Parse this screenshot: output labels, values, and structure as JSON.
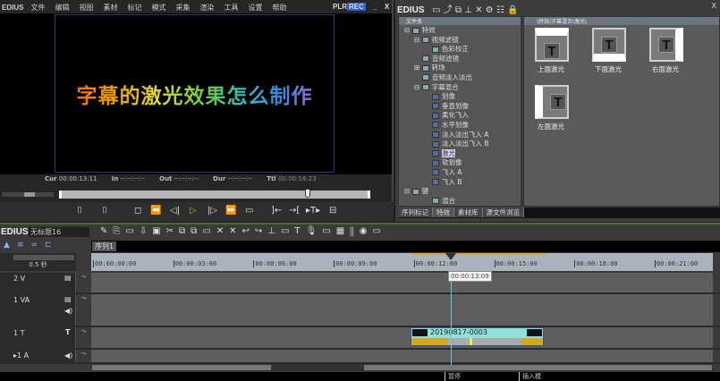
{
  "app": {
    "name": "EDIUS",
    "menu": [
      "文件",
      "编辑",
      "视图",
      "素材",
      "标记",
      "模式",
      "采集",
      "渲染",
      "工具",
      "设置",
      "帮助"
    ],
    "plr": "PLR",
    "rec": "REC",
    "minimize": "_",
    "close": "X"
  },
  "preview": {
    "title_text": "字幕的激光效果怎么制作",
    "cur_label": "Cur",
    "cur": "00:00:13:11",
    "in_label": "In",
    "in": "--:--:--:--",
    "out_label": "Out",
    "out": "--:--:--:--",
    "dur_label": "Dur",
    "dur": "--:--:--:--",
    "ttl_label": "Ttl",
    "ttl": "00:00:16:23",
    "playhead_fraction": 0.82
  },
  "transport": {
    "buttons": [
      "⌷",
      "⌷",
      "◻",
      "⏪",
      "◁|",
      "▷",
      "|▷",
      "⏩",
      "▭",
      "]←",
      "→[",
      "▸T▸",
      "⊟"
    ]
  },
  "effects": {
    "app": "EDIUS",
    "close": "X",
    "folder_header": "文件夹",
    "path": "\\特效\\字幕混合\\激光\\",
    "tree": [
      {
        "label": "特效",
        "level": 0,
        "exp": "⊟"
      },
      {
        "label": "视频滤镜",
        "level": 1,
        "exp": "⊟"
      },
      {
        "label": "色彩校正",
        "level": 2
      },
      {
        "label": "音频滤镜",
        "level": 1
      },
      {
        "label": "转场",
        "level": 1,
        "exp": "⊞"
      },
      {
        "label": "音频淡入淡出",
        "level": 1
      },
      {
        "label": "字幕混合",
        "level": 1,
        "exp": "⊟"
      },
      {
        "label": "划像",
        "level": 2,
        "t": true
      },
      {
        "label": "垂直划像",
        "level": 2,
        "t": true
      },
      {
        "label": "柔化飞入",
        "level": 2,
        "t": true
      },
      {
        "label": "水平划像",
        "level": 2,
        "t": true
      },
      {
        "label": "淡入淡出飞入 A",
        "level": 2,
        "t": true
      },
      {
        "label": "淡入淡出飞入 B",
        "level": 2,
        "t": true
      },
      {
        "label": "激光",
        "level": 2,
        "t": true,
        "selected": true
      },
      {
        "label": "软划像",
        "level": 2,
        "t": true
      },
      {
        "label": "飞入 A",
        "level": 2,
        "t": true
      },
      {
        "label": "飞入 B",
        "level": 2,
        "t": true
      },
      {
        "label": "键",
        "level": 0,
        "exp": "⊟"
      },
      {
        "label": "混合",
        "level": 2
      }
    ],
    "tiles": [
      "上面激光",
      "下面激光",
      "右面激光",
      "左面激光"
    ],
    "tabs": [
      "序列标记",
      "特效",
      "素材库",
      "源文件浏览"
    ]
  },
  "timeline": {
    "app": "EDIUS",
    "project": "无标题16",
    "sequence_tab": "序列1",
    "scale": "0.5 秒",
    "ruler": [
      "00:00:00:00",
      "00:00:03:00",
      "00:00:06:00",
      "00:00:09:00",
      "00:00:12:00",
      "00:00:15:00",
      "00:00:18:00",
      "00:00:21:00"
    ],
    "playhead_tooltip": "00:00:13:09",
    "tracks": [
      {
        "name": "2 V"
      },
      {
        "name": "1 VA"
      },
      {
        "name": "1 T"
      },
      {
        "name": "▸1 A"
      }
    ],
    "clip": {
      "name": "20190817-0003"
    },
    "status": [
      "暂停",
      "插入模"
    ]
  },
  "colors": {
    "accent": "#2f5fd0",
    "clip": "#8fe0d8",
    "panel": "#5e5e5e"
  }
}
